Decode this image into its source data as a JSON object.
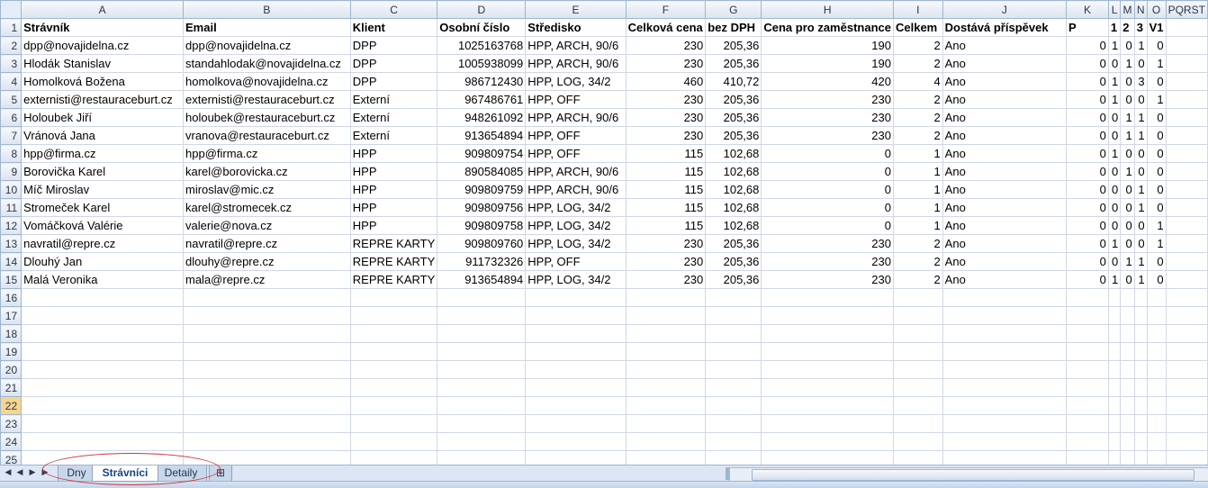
{
  "columns": [
    "A",
    "B",
    "C",
    "D",
    "E",
    "F",
    "G",
    "H",
    "I",
    "J",
    "K",
    "L",
    "M",
    "N",
    "O",
    "P",
    "Q",
    "R",
    "S",
    "T"
  ],
  "col_header_labels": [
    "A",
    "B",
    "C",
    "D",
    "E",
    "F",
    "G",
    "H",
    "I",
    "J",
    "K",
    "L",
    "M",
    "N",
    "O",
    "PQRST"
  ],
  "header_row": [
    "Strávník",
    "Email",
    "Klient",
    "Osobní číslo",
    "Středisko",
    "Celková cena",
    "bez DPH",
    "Cena pro zaměstnance",
    "Celkem",
    "Dostává příspěvek",
    "P",
    "1",
    "2",
    "3",
    "V1"
  ],
  "rows": [
    [
      "dpp@novajidelna.cz",
      "dpp@novajidelna.cz",
      "DPP",
      "1025163768",
      "HPP, ARCH, 90/6",
      "230",
      "205,36",
      "190",
      "2",
      "Ano",
      "0",
      "1",
      "0",
      "1",
      "0"
    ],
    [
      "Hlodák Stanislav",
      "standahlodak@novajidelna.cz",
      "DPP",
      "1005938099",
      "HPP, ARCH, 90/6",
      "230",
      "205,36",
      "190",
      "2",
      "Ano",
      "0",
      "0",
      "1",
      "0",
      "1"
    ],
    [
      "Homolková Božena",
      "homolkova@novajidelna.cz",
      "DPP",
      "986712430",
      "HPP, LOG, 34/2",
      "460",
      "410,72",
      "420",
      "4",
      "Ano",
      "0",
      "1",
      "0",
      "3",
      "0"
    ],
    [
      "externisti@restauraceburt.cz",
      "externisti@restauraceburt.cz",
      "Externí",
      "967486761",
      "HPP, OFF",
      "230",
      "205,36",
      "230",
      "2",
      "Ano",
      "0",
      "1",
      "0",
      "0",
      "1"
    ],
    [
      "Holoubek Jiří",
      "holoubek@restauraceburt.cz",
      "Externí",
      "948261092",
      "HPP, ARCH, 90/6",
      "230",
      "205,36",
      "230",
      "2",
      "Ano",
      "0",
      "0",
      "1",
      "1",
      "0"
    ],
    [
      "Vránová Jana",
      "vranova@restauraceburt.cz",
      "Externí",
      "913654894",
      "HPP, OFF",
      "230",
      "205,36",
      "230",
      "2",
      "Ano",
      "0",
      "0",
      "1",
      "1",
      "0"
    ],
    [
      "hpp@firma.cz",
      "hpp@firma.cz",
      "HPP",
      "909809754",
      "HPP, OFF",
      "115",
      "102,68",
      "0",
      "1",
      "Ano",
      "0",
      "1",
      "0",
      "0",
      "0"
    ],
    [
      "Borovička Karel",
      "karel@borovicka.cz",
      "HPP",
      "890584085",
      "HPP, ARCH, 90/6",
      "115",
      "102,68",
      "0",
      "1",
      "Ano",
      "0",
      "0",
      "1",
      "0",
      "0"
    ],
    [
      "Míč Miroslav",
      "miroslav@mic.cz",
      "HPP",
      "909809759",
      "HPP, ARCH, 90/6",
      "115",
      "102,68",
      "0",
      "1",
      "Ano",
      "0",
      "0",
      "0",
      "1",
      "0"
    ],
    [
      "Stromeček Karel",
      "karel@stromecek.cz",
      "HPP",
      "909809756",
      "HPP, LOG, 34/2",
      "115",
      "102,68",
      "0",
      "1",
      "Ano",
      "0",
      "0",
      "0",
      "1",
      "0"
    ],
    [
      "Vomáčková Valérie",
      "valerie@nova.cz",
      "HPP",
      "909809758",
      "HPP, LOG, 34/2",
      "115",
      "102,68",
      "0",
      "1",
      "Ano",
      "0",
      "0",
      "0",
      "0",
      "1"
    ],
    [
      "navratil@repre.cz",
      "navratil@repre.cz",
      "REPRE KARTY",
      "909809760",
      "HPP, LOG, 34/2",
      "230",
      "205,36",
      "230",
      "2",
      "Ano",
      "0",
      "1",
      "0",
      "0",
      "1"
    ],
    [
      "Dlouhý Jan",
      "dlouhy@repre.cz",
      "REPRE KARTY",
      "911732326",
      "HPP, OFF",
      "230",
      "205,36",
      "230",
      "2",
      "Ano",
      "0",
      "0",
      "1",
      "1",
      "0"
    ],
    [
      "Malá Veronika",
      "mala@repre.cz",
      "REPRE KARTY",
      "913654894",
      "HPP, LOG, 34/2",
      "230",
      "205,36",
      "230",
      "2",
      "Ano",
      "0",
      "1",
      "0",
      "1",
      "0"
    ]
  ],
  "empty_row_numbers": [
    "16",
    "17",
    "18",
    "19",
    "20",
    "21",
    "22",
    "23",
    "24",
    "25"
  ],
  "selected_row": "22",
  "numeric_columns": [
    3,
    5,
    6,
    7,
    8,
    10,
    11,
    12,
    13,
    14
  ],
  "sheet_tabs": [
    {
      "label": "Dny",
      "active": false
    },
    {
      "label": "Strávníci",
      "active": true
    },
    {
      "label": "Detaily",
      "active": false
    }
  ],
  "colors": {
    "grid_line": "#d0d7e5",
    "header_bg": "#dde4ee",
    "highlight_ellipse": "#d0343a",
    "active_tab_text": "#15428b"
  }
}
